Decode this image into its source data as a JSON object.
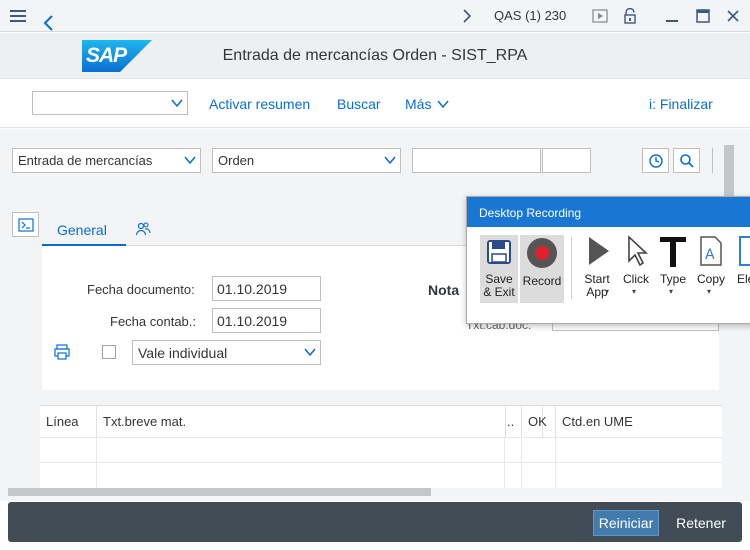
{
  "titlebar": {
    "system": "QAS (1) 230",
    "menu_icon": "hamburger-icon",
    "icons": [
      "chevron-right-icon",
      "play-icon",
      "lock-icon",
      "minimize-icon",
      "maximize-icon",
      "close-icon"
    ]
  },
  "header": {
    "logo_text": "SAP",
    "title": "Entrada de mercancías Orden - SIST_RPA"
  },
  "toolbar": {
    "select_value": "",
    "activar_resumen": "Activar resumen",
    "buscar": "Buscar",
    "mas": "Más",
    "finalizar": "i: Finalizar"
  },
  "filters": {
    "transaction": "Entrada de mercancías",
    "reference": "Orden",
    "field1": "",
    "field2": ""
  },
  "tabs": [
    {
      "label": "General"
    }
  ],
  "general": {
    "fecha_documento_label": "Fecha documento:",
    "fecha_documento": "01.10.2019",
    "fecha_contab_label": "Fecha contab.:",
    "fecha_contab": "01.10.2019",
    "vale": "Vale individual",
    "nota_label": "Nota",
    "txt_cab_label": "Txt.cab.doc."
  },
  "table": {
    "headers": [
      "Línea",
      "Txt.breve mat.",
      "..",
      "OK",
      "Ctd.en UME"
    ]
  },
  "footer": {
    "reiniciar": "Reiniciar",
    "retener": "Retener"
  },
  "recorder": {
    "title": "Desktop Recording",
    "save_exit": "Save & Exit",
    "record": "Record",
    "start_app": "Start App",
    "click": "Click",
    "type": "Type",
    "copy": "Copy",
    "element": "Ele"
  },
  "colors": {
    "sap_blue": "#0a6ed1",
    "footer_bg": "#414c57",
    "emphasized_button": "#427cac",
    "recorder_titlebar": "#1976d2",
    "record_red": "#e0202f"
  }
}
